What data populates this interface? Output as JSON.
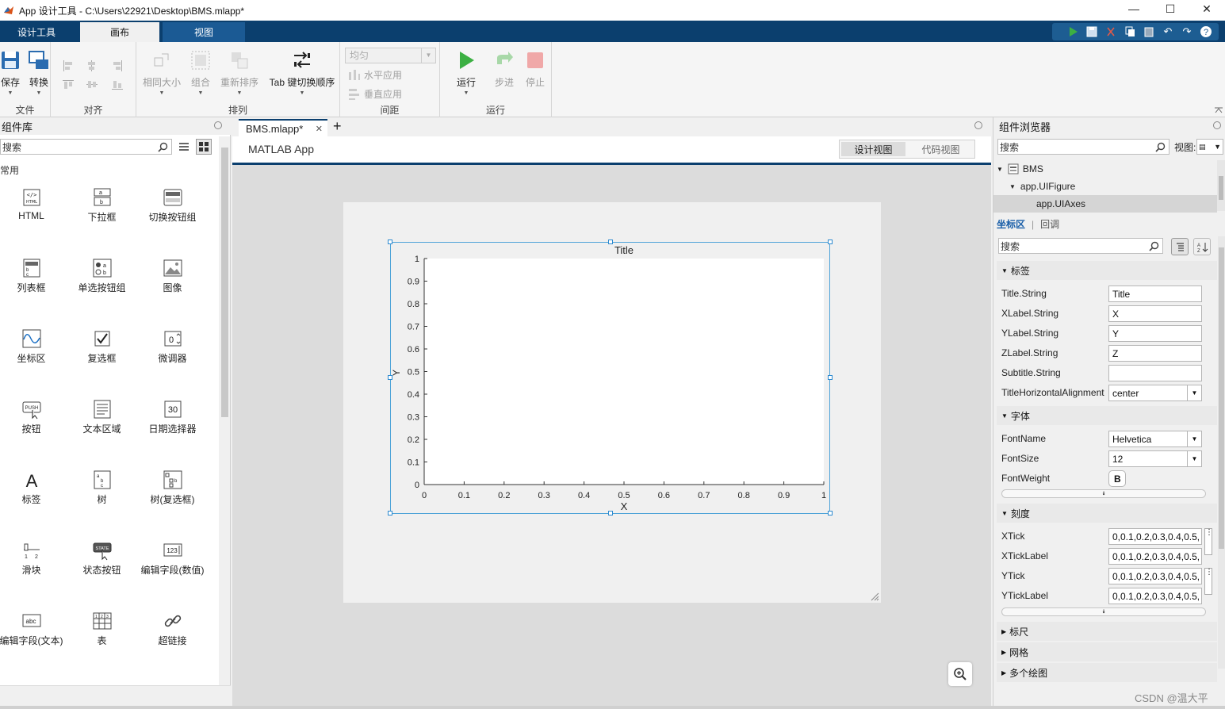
{
  "window": {
    "title": "App 设计工具 - C:\\Users\\22921\\Desktop\\BMS.mlapp*",
    "minimize": "—",
    "maximize": "☐",
    "close": "✕"
  },
  "ribbon": {
    "tabs": [
      {
        "label": "设计工具"
      },
      {
        "label": "画布"
      },
      {
        "label": "视图"
      }
    ],
    "active_tab": "画布",
    "file": {
      "save": "保存",
      "convert": "转换",
      "label": "文件"
    },
    "align": {
      "label": "对齐"
    },
    "arrange": {
      "same_size": "相同大小",
      "group": "组合",
      "reorder": "重新排序",
      "tab_order": "Tab 键切换顺序",
      "label": "排列"
    },
    "spacing": {
      "select": "均匀",
      "horizontal": "水平应用",
      "vertical": "垂直应用",
      "label": "间距"
    },
    "run": {
      "run": "运行",
      "step": "步进",
      "stop": "停止",
      "label": "运行"
    }
  },
  "library": {
    "title": "组件库",
    "search_placeholder": "搜索",
    "category": "常用",
    "components": [
      {
        "label": "HTML",
        "icon": "html-icon"
      },
      {
        "label": "下拉框",
        "icon": "dropdown-icon"
      },
      {
        "label": "切换按钮组",
        "icon": "toggle-button-group-icon"
      },
      {
        "label": "列表框",
        "icon": "listbox-icon"
      },
      {
        "label": "单选按钮组",
        "icon": "radio-button-group-icon"
      },
      {
        "label": "图像",
        "icon": "image-icon"
      },
      {
        "label": "坐标区",
        "icon": "axes-icon"
      },
      {
        "label": "复选框",
        "icon": "checkbox-icon"
      },
      {
        "label": "微调器",
        "icon": "spinner-icon"
      },
      {
        "label": "按钮",
        "icon": "push-button-icon"
      },
      {
        "label": "文本区域",
        "icon": "text-area-icon"
      },
      {
        "label": "日期选择器",
        "icon": "date-picker-icon"
      },
      {
        "label": "标签",
        "icon": "label-icon"
      },
      {
        "label": "树",
        "icon": "tree-icon"
      },
      {
        "label": "树(复选框)",
        "icon": "checkbox-tree-icon"
      },
      {
        "label": "滑块",
        "icon": "slider-icon"
      },
      {
        "label": "状态按钮",
        "icon": "state-button-icon"
      },
      {
        "label": "编辑字段(数值)",
        "icon": "numeric-field-icon"
      },
      {
        "label": "编辑字段(文本)",
        "icon": "text-field-icon"
      },
      {
        "label": "表",
        "icon": "table-icon"
      },
      {
        "label": "超链接",
        "icon": "hyperlink-icon"
      }
    ]
  },
  "document": {
    "tab": "BMS.mlapp*",
    "app_title": "MATLAB App",
    "design_view": "设计视图",
    "code_view": "代码视图"
  },
  "axes": {
    "title": "Title",
    "xlabel": "X",
    "ylabel": "Y",
    "xticks": [
      "0",
      "0.1",
      "0.2",
      "0.3",
      "0.4",
      "0.5",
      "0.6",
      "0.7",
      "0.8",
      "0.9",
      "1"
    ],
    "yticks": [
      "0",
      "0.1",
      "0.2",
      "0.3",
      "0.4",
      "0.5",
      "0.6",
      "0.7",
      "0.8",
      "0.9",
      "1"
    ]
  },
  "browser": {
    "title": "组件浏览器",
    "search_placeholder": "搜索",
    "view_label": "视图:",
    "tree": [
      {
        "label": "BMS"
      },
      {
        "label": "app.UIFigure"
      },
      {
        "label": "app.UIAxes"
      }
    ],
    "tabs": {
      "props": "坐标区",
      "callbacks": "回调"
    },
    "props_search": "搜索",
    "sections": {
      "labels": "标签",
      "font": "字体",
      "ticks": "刻度",
      "ruler": "标尺",
      "grid": "网格",
      "multi": "多个绘图"
    },
    "label_props": [
      {
        "name": "Title.String",
        "value": "Title"
      },
      {
        "name": "XLabel.String",
        "value": "X"
      },
      {
        "name": "YLabel.String",
        "value": "Y"
      },
      {
        "name": "ZLabel.String",
        "value": "Z"
      },
      {
        "name": "Subtitle.String",
        "value": ""
      },
      {
        "name": "TitleHorizontalAlignment",
        "value": "center"
      }
    ],
    "font_props": [
      {
        "name": "FontName",
        "value": "Helvetica"
      },
      {
        "name": "FontSize",
        "value": "12"
      },
      {
        "name": "FontWeight",
        "value": "B"
      }
    ],
    "tick_props": [
      {
        "name": "XTick",
        "value": "0,0.1,0.2,0.3,0.4,0.5,"
      },
      {
        "name": "XTickLabel",
        "value": "0,0.1,0.2,0.3,0.4,0.5,"
      },
      {
        "name": "YTick",
        "value": "0,0.1,0.2,0.3,0.4,0.5,"
      },
      {
        "name": "YTickLabel",
        "value": "0,0.1,0.2,0.3,0.4,0.5,"
      }
    ]
  },
  "watermark": "CSDN @温大平"
}
